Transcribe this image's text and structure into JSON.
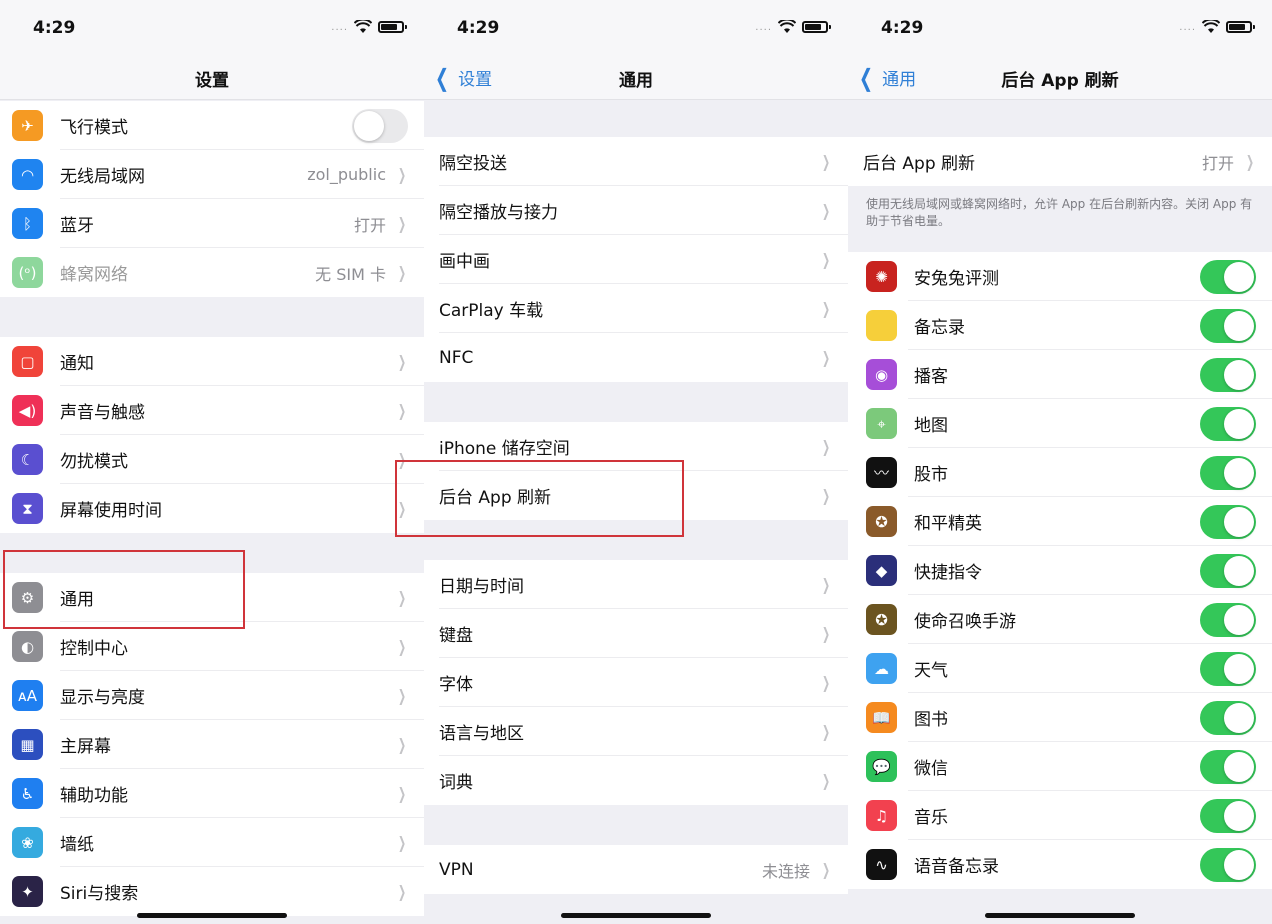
{
  "status_bar": {
    "time": "4:29",
    "signal": "....",
    "wifi_icon": "wifi-icon",
    "battery_icon": "battery-icon"
  },
  "colors": {
    "accent_blue": "#2f7fd6",
    "toggle_on": "#34c759",
    "highlight_red": "#d0343a"
  },
  "panel_settings": {
    "title": "设置",
    "groups": [
      [
        {
          "label": "飞行模式",
          "icon": "airplane-icon",
          "icon_color": "#f59a23",
          "toggle": false
        },
        {
          "label": "无线局域网",
          "icon": "wifi-icon",
          "icon_color": "#1f84f0",
          "value": "zol_public"
        },
        {
          "label": "蓝牙",
          "icon": "bluetooth-icon",
          "icon_color": "#1f84f0",
          "value": "打开"
        },
        {
          "label": "蜂窝网络",
          "icon": "cellular-icon",
          "icon_color": "#8ed79c",
          "value": "无 SIM 卡",
          "dimmed": true
        }
      ],
      [
        {
          "label": "通知",
          "icon": "notifications-icon",
          "icon_color": "#f0443a"
        },
        {
          "label": "声音与触感",
          "icon": "sound-icon",
          "icon_color": "#ef3057"
        },
        {
          "label": "勿扰模式",
          "icon": "moon-icon",
          "icon_color": "#5a4fd0"
        },
        {
          "label": "屏幕使用时间",
          "icon": "hourglass-icon",
          "icon_color": "#5a4fd0"
        }
      ],
      [
        {
          "label": "通用",
          "icon": "gear-icon",
          "icon_color": "#8e8e93"
        },
        {
          "label": "控制中心",
          "icon": "control-center-icon",
          "icon_color": "#8e8e93"
        },
        {
          "label": "显示与亮度",
          "icon": "display-icon",
          "icon_color": "#1f7ff0"
        },
        {
          "label": "主屏幕",
          "icon": "home-screen-icon",
          "icon_color": "#2c4fbf"
        },
        {
          "label": "辅助功能",
          "icon": "accessibility-icon",
          "icon_color": "#1f7ff0"
        },
        {
          "label": "墙纸",
          "icon": "wallpaper-icon",
          "icon_color": "#35aadf"
        },
        {
          "label": "Siri与搜索",
          "icon": "siri-icon",
          "icon_color": "#2a2347"
        }
      ]
    ]
  },
  "panel_general": {
    "back_label": "设置",
    "title": "通用",
    "groups": [
      [
        {
          "label": "隔空投送"
        },
        {
          "label": "隔空播放与接力"
        },
        {
          "label": "画中画"
        },
        {
          "label": "CarPlay 车载"
        },
        {
          "label": "NFC"
        }
      ],
      [
        {
          "label": "iPhone 储存空间"
        },
        {
          "label": "后台 App 刷新"
        }
      ],
      [
        {
          "label": "日期与时间"
        },
        {
          "label": "键盘"
        },
        {
          "label": "字体"
        },
        {
          "label": "语言与地区"
        },
        {
          "label": "词典"
        }
      ],
      [
        {
          "label": "VPN",
          "value": "未连接"
        }
      ]
    ]
  },
  "panel_bg_refresh": {
    "back_label": "通用",
    "title": "后台 App 刷新",
    "main_row": {
      "label": "后台 App 刷新",
      "value": "打开"
    },
    "footer_note": "使用无线局域网或蜂窝网络时，允许 App 在后台刷新内容。关闭 App 有助于节省电量。",
    "apps": [
      {
        "label": "安兔兔评测",
        "icon": "antutu-icon",
        "icon_color": "#c8231f",
        "enabled": true
      },
      {
        "label": "备忘录",
        "icon": "notes-icon",
        "icon_color": "#f6cf3a",
        "enabled": true
      },
      {
        "label": "播客",
        "icon": "podcasts-icon",
        "icon_color": "#a64ed8",
        "enabled": true
      },
      {
        "label": "地图",
        "icon": "maps-icon",
        "icon_color": "#7cc97b",
        "enabled": true
      },
      {
        "label": "股市",
        "icon": "stocks-icon",
        "icon_color": "#111111",
        "enabled": true
      },
      {
        "label": "和平精英",
        "icon": "game-pubg-icon",
        "icon_color": "#8a5a2a",
        "enabled": true
      },
      {
        "label": "快捷指令",
        "icon": "shortcuts-icon",
        "icon_color": "#2b2f7a",
        "enabled": true
      },
      {
        "label": "使命召唤手游",
        "icon": "game-cod-icon",
        "icon_color": "#6b5420",
        "enabled": true
      },
      {
        "label": "天气",
        "icon": "weather-icon",
        "icon_color": "#3ea2f0",
        "enabled": true
      },
      {
        "label": "图书",
        "icon": "books-icon",
        "icon_color": "#f58a1f",
        "enabled": true
      },
      {
        "label": "微信",
        "icon": "wechat-icon",
        "icon_color": "#2dc15a",
        "enabled": true
      },
      {
        "label": "音乐",
        "icon": "music-icon",
        "icon_color": "#f2414f",
        "enabled": true
      },
      {
        "label": "语音备忘录",
        "icon": "voice-memos-icon",
        "icon_color": "#111111",
        "enabled": true
      }
    ]
  },
  "glyphs": {
    "airplane-icon": "✈",
    "wifi-icon": "◠",
    "bluetooth-icon": "ᛒ",
    "cellular-icon": "(ᵒ)",
    "notifications-icon": "▢",
    "sound-icon": "◀)",
    "moon-icon": "☾",
    "hourglass-icon": "⧗",
    "gear-icon": "⚙",
    "control-center-icon": "◐",
    "display-icon": "ᴀA",
    "home-screen-icon": "▦",
    "accessibility-icon": "♿",
    "wallpaper-icon": "❀",
    "siri-icon": "✦",
    "antutu-icon": "✺",
    "notes-icon": "",
    "podcasts-icon": "◉",
    "maps-icon": "⌖",
    "stocks-icon": "〰",
    "game-pubg-icon": "✪",
    "shortcuts-icon": "◆",
    "game-cod-icon": "✪",
    "weather-icon": "☁",
    "books-icon": "📖",
    "wechat-icon": "💬",
    "music-icon": "♫",
    "voice-memos-icon": "∿",
    "chevron": "❯",
    "back-chevron": "〈"
  }
}
